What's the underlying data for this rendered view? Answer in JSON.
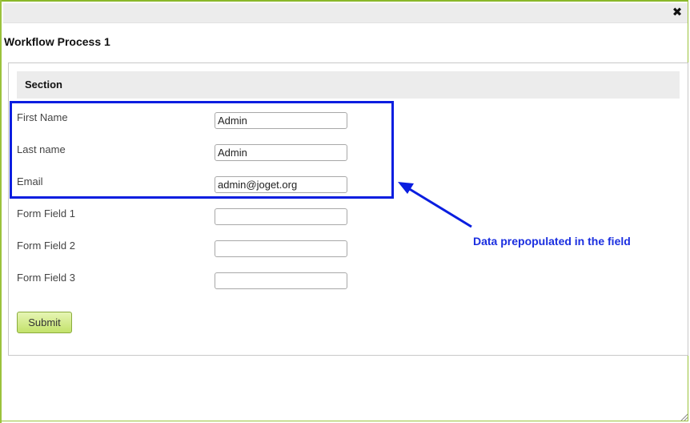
{
  "dialog": {
    "title": "Workflow Process 1",
    "close_icon": "close-icon"
  },
  "section": {
    "title": "Section"
  },
  "fields": [
    {
      "label": "First Name",
      "value": "Admin"
    },
    {
      "label": "Last name",
      "value": "Admin"
    },
    {
      "label": "Email",
      "value": "admin@joget.org"
    },
    {
      "label": "Form Field 1",
      "value": ""
    },
    {
      "label": "Form Field 2",
      "value": ""
    },
    {
      "label": "Form Field 3",
      "value": ""
    }
  ],
  "submit_label": "Submit",
  "annotation": {
    "text": "Data prepopulated in the field",
    "color": "#1a2ee0"
  },
  "colors": {
    "accent_border": "#9bc23c",
    "highlight": "#0a1ee0",
    "submit_button": "#c3e26b"
  }
}
